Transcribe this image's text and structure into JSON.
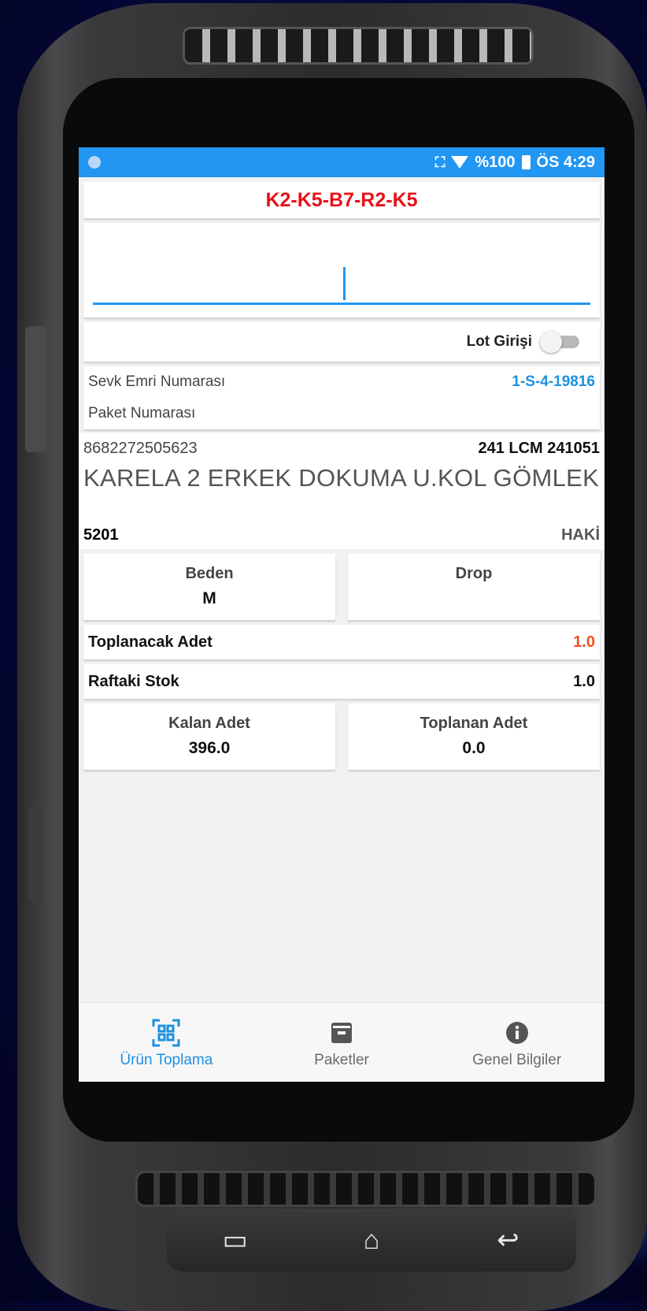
{
  "status_bar": {
    "battery": "%100",
    "time": "ÖS 4:29"
  },
  "location_code": "K2-K5-B7-R2-K5",
  "barcode_input": {
    "value": "",
    "placeholder": ""
  },
  "lot": {
    "label": "Lot Girişi",
    "enabled": false
  },
  "shipment": {
    "order_label": "Sevk Emri Numarası",
    "order_value": "1-S-4-19816",
    "package_label": "Paket Numarası",
    "package_value": ""
  },
  "product": {
    "barcode": "8682272505623",
    "code": "241 LCM 241051",
    "name": "KARELA 2 ERKEK DOKUMA U.KOL GÖMLEK",
    "model": "5201",
    "color": "HAKİ"
  },
  "size": {
    "label": "Beden",
    "value": "M"
  },
  "drop": {
    "label": "Drop",
    "value": ""
  },
  "to_collect": {
    "label": "Toplanacak Adet",
    "value": "1.0"
  },
  "shelf_stock": {
    "label": "Raftaki Stok",
    "value": "1.0"
  },
  "remaining": {
    "label": "Kalan Adet",
    "value": "396.0"
  },
  "collected": {
    "label": "Toplanan Adet",
    "value": "0.0"
  },
  "bottom_nav": {
    "items": [
      {
        "label": "Ürün Toplama",
        "icon": "qr-scan-icon",
        "active": true
      },
      {
        "label": "Paketler",
        "icon": "package-icon",
        "active": false
      },
      {
        "label": "Genel Bilgiler",
        "icon": "info-icon",
        "active": false
      }
    ]
  },
  "colors": {
    "accent": "#2196f3",
    "location_red": "#e8121a",
    "link_blue": "#1e90e0",
    "quantity_orange": "#f25022"
  }
}
